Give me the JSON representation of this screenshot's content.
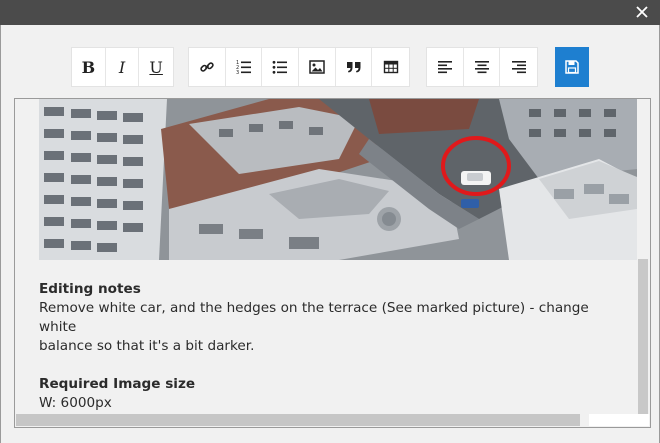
{
  "window": {
    "close_icon": "close-icon",
    "colors": {
      "titlebar": "#4b4b4b",
      "dialog_bg": "#f1f1f1",
      "accent": "#1e7fd0",
      "marker_circle": "#e0191b"
    }
  },
  "toolbar": {
    "format_group": [
      {
        "name": "bold-button",
        "glyph": "B"
      },
      {
        "name": "italic-button",
        "glyph": "I"
      },
      {
        "name": "underline-button",
        "glyph": "U"
      }
    ],
    "insert_group": [
      {
        "name": "link-button",
        "icon": "link-icon"
      },
      {
        "name": "ordered-list-button",
        "icon": "ordered-list-icon"
      },
      {
        "name": "bullet-list-button",
        "icon": "bullet-list-icon"
      },
      {
        "name": "image-button",
        "icon": "image-icon"
      },
      {
        "name": "quote-button",
        "icon": "quote-icon"
      },
      {
        "name": "table-button",
        "icon": "table-icon"
      }
    ],
    "align_group": [
      {
        "name": "align-left-button",
        "icon": "align-left-icon"
      },
      {
        "name": "align-center-button",
        "icon": "align-center-icon"
      },
      {
        "name": "align-right-button",
        "icon": "align-right-icon"
      }
    ],
    "save": {
      "icon": "save-icon"
    }
  },
  "content": {
    "image": {
      "subject": "aerial-city-rooftops-photo",
      "annotation": "red circle around white car"
    },
    "editing_notes_heading": "Editing notes",
    "editing_notes_text_1": "Remove white car, and the hedges on the terrace (See marked picture) - change white",
    "editing_notes_text_2": "balance so that it's a bit darker.",
    "required_size_heading": "Required Image size",
    "required_size_value": "W: 6000px"
  }
}
